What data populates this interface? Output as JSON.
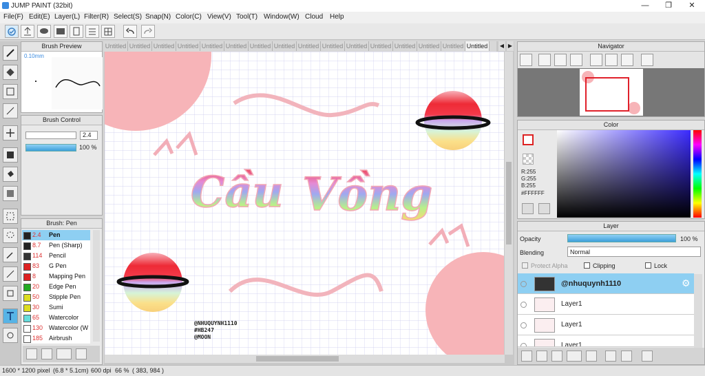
{
  "app": {
    "title": "JUMP PAINT (32bit)"
  },
  "menu": [
    "File(F)",
    "Edit(E)",
    "Layer(L)",
    "Filter(R)",
    "Select(S)",
    "Snap(N)",
    "Color(C)",
    "View(V)",
    "Tool(T)",
    "Window(W)",
    "Cloud",
    "Help"
  ],
  "brush_preview": {
    "title": "Brush Preview",
    "size_label": "0.10mm"
  },
  "brush_control": {
    "title": "Brush Control",
    "size_value": "2.4",
    "opacity_value": "100 %"
  },
  "brush_list": {
    "title": "Brush: Pen",
    "items": [
      {
        "size": "2.4",
        "name": "Pen",
        "color": "#222222"
      },
      {
        "size": "8.7",
        "name": "Pen (Sharp)",
        "color": "#222222"
      },
      {
        "size": "114",
        "name": "Pencil",
        "color": "#333333"
      },
      {
        "size": "83",
        "name": "G Pen",
        "color": "#dd2222"
      },
      {
        "size": "8",
        "name": "Mapping Pen",
        "color": "#dd2222"
      },
      {
        "size": "20",
        "name": "Edge Pen",
        "color": "#22aa22"
      },
      {
        "size": "50",
        "name": "Stipple Pen",
        "color": "#dddd22"
      },
      {
        "size": "30",
        "name": "Sumi",
        "color": "#dddd22"
      },
      {
        "size": "65",
        "name": "Watercolor",
        "color": "#66dddd"
      },
      {
        "size": "130",
        "name": "Watercolor (W",
        "color": "#ffffff"
      },
      {
        "size": "185",
        "name": "Airbrush",
        "color": "#ffffff"
      }
    ]
  },
  "tabs": {
    "label": "Untitled",
    "count": 16
  },
  "canvas": {
    "title_word_1": "Cầu",
    "title_word_2": "Vồng",
    "credits": [
      "@NHUQUYNH1110",
      "#HB247",
      "@MOON"
    ]
  },
  "navigator": {
    "title": "Navigator"
  },
  "color": {
    "title": "Color",
    "r": "R:255",
    "g": "G:255",
    "b": "B:255",
    "hex": "#FFFFFF"
  },
  "layer": {
    "title": "Layer",
    "opacity_label": "Opacity",
    "opacity_value": "100 %",
    "blending_label": "Blending",
    "blending_value": "Normal",
    "protect_alpha": "Protect Alpha",
    "clipping": "Clipping",
    "lock": "Lock",
    "items": [
      "@nhuquynh1110",
      "Layer1",
      "Layer1",
      "Layer1"
    ]
  },
  "status": {
    "size": "1600 * 1200 pixel",
    "dimensions": "(6.8 * 5.1cm)",
    "dpi": "600 dpi",
    "zoom": "66 %",
    "coords": "( 383, 984 )"
  },
  "colors": {
    "accent": "#57b4e6",
    "selected_row": "#8ecff2",
    "pink": "#f7b4b8"
  }
}
